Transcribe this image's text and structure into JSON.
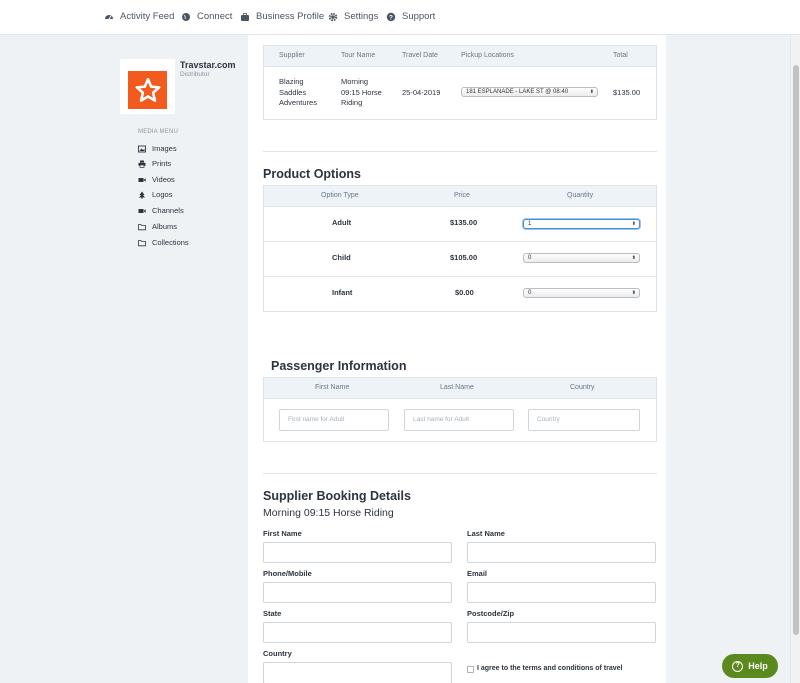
{
  "topnav": {
    "items": [
      {
        "label": "Activity Feed",
        "icon": "dashboard-icon"
      },
      {
        "label": "Connect",
        "icon": "globe-icon"
      },
      {
        "label": "Business Profile",
        "icon": "briefcase-icon"
      },
      {
        "label": "Settings",
        "icon": "gear-icon"
      },
      {
        "label": "Support",
        "icon": "question-icon"
      }
    ]
  },
  "sidebar": {
    "company_name": "Travstar.com",
    "company_role": "Distributor",
    "media_menu_title": "MEDIA MENU",
    "items": [
      {
        "label": "Images",
        "icon": "image-icon"
      },
      {
        "label": "Prints",
        "icon": "printer-icon"
      },
      {
        "label": "Videos",
        "icon": "video-icon"
      },
      {
        "label": "Logos",
        "icon": "tree-icon"
      },
      {
        "label": "Channels",
        "icon": "video-icon"
      },
      {
        "label": "Albums",
        "icon": "folder-icon"
      },
      {
        "label": "Collections",
        "icon": "folder-icon"
      }
    ]
  },
  "tour_table": {
    "headers": [
      "Supplier",
      "Tour Name",
      "Travel Date",
      "Pickup Locations",
      "Total"
    ],
    "row": {
      "supplier": [
        "Blazing",
        "Saddles",
        "Adventures"
      ],
      "tour_name": [
        "Morning",
        "09:15 Horse",
        "Riding"
      ],
      "travel_date": "25-04-2019",
      "pickup": "181 ESPLANADE - LAKE ST @ 08:40",
      "total": "$135.00"
    }
  },
  "product_options": {
    "title": "Product Options",
    "headers": [
      "Option Type",
      "Price",
      "Quantity"
    ],
    "rows": [
      {
        "type": "Adult",
        "price": "$135.00",
        "qty": "1"
      },
      {
        "type": "Child",
        "price": "$105.00",
        "qty": "0"
      },
      {
        "type": "Infant",
        "price": "$0.00",
        "qty": "0"
      }
    ]
  },
  "passenger": {
    "title": "Passenger Information",
    "headers": [
      "First Name",
      "Last Name",
      "Country"
    ],
    "placeholders": [
      "First name for Adult",
      "Last name for Adult",
      "Country"
    ]
  },
  "supplier_booking": {
    "title": "Supplier Booking Details",
    "subtitle": "Morning 09:15 Horse Riding",
    "labels": {
      "first_name": "First Name",
      "last_name": "Last Name",
      "phone": "Phone/Mobile",
      "email": "Email",
      "state": "State",
      "postcode": "Postcode/Zip",
      "country": "Country"
    },
    "terms": "I agree to the terms and conditions of travel"
  },
  "help_button": {
    "label": "Help"
  },
  "colors": {
    "accent": "#f25a1e",
    "help": "#5a8a1e",
    "focus": "#4a90d9"
  }
}
